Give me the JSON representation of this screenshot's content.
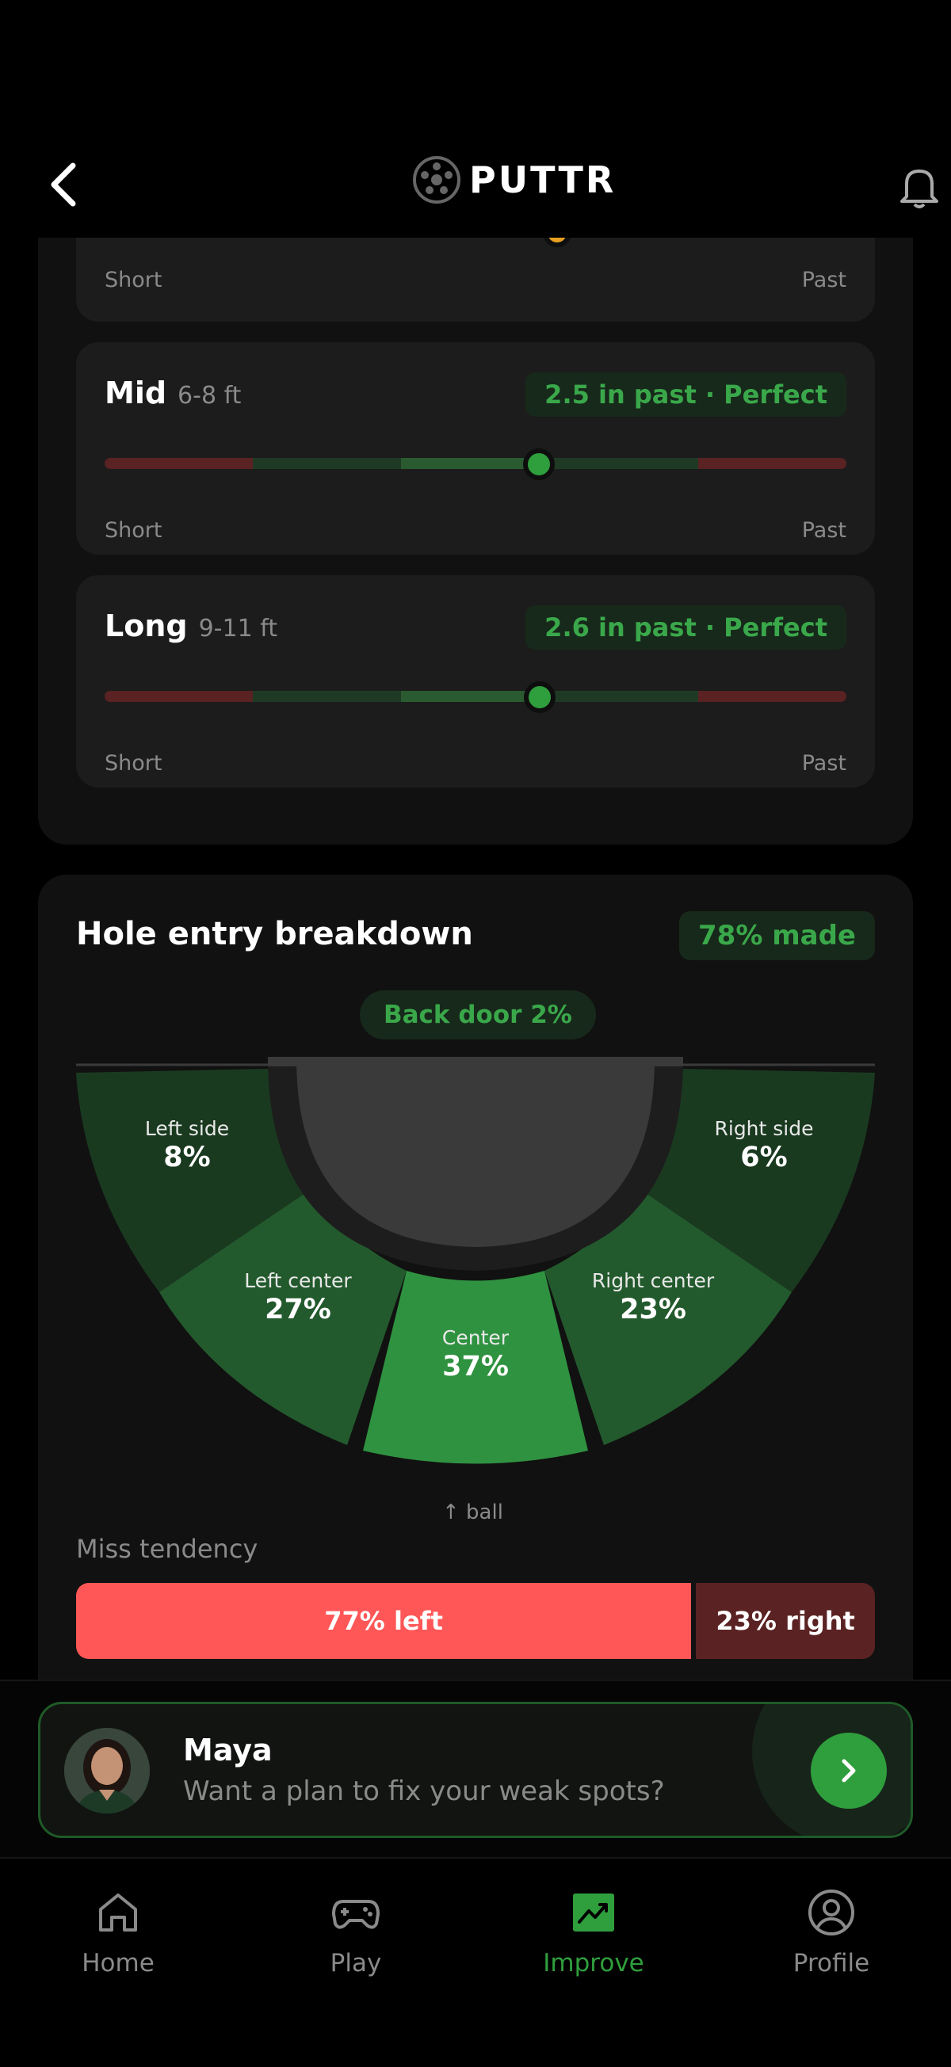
{
  "header": {
    "logo_text": "PUTTR"
  },
  "distance_rows": {
    "top": {
      "short": "Short",
      "past": "Past"
    },
    "mid": {
      "title": "Mid",
      "range": "6-8 ft",
      "badge": "2.5 in past · Perfect",
      "short": "Short",
      "past": "Past",
      "position": 0.585
    },
    "long": {
      "title": "Long",
      "range": "9-11 ft",
      "badge": "2.6 in past · Perfect",
      "short": "Short",
      "past": "Past",
      "position": 0.587
    }
  },
  "hole_entry": {
    "title": "Hole entry breakdown",
    "made_badge": "78% made",
    "backdoor": "Back door 2%",
    "sectors": [
      {
        "name": "Left side",
        "value": "8%"
      },
      {
        "name": "Left center",
        "value": "27%"
      },
      {
        "name": "Center",
        "value": "37%"
      },
      {
        "name": "Right center",
        "value": "23%"
      },
      {
        "name": "Right side",
        "value": "6%"
      }
    ],
    "ball_label": "↑ ball",
    "miss_tendency_label": "Miss tendency",
    "miss_left": "77% left",
    "miss_right": "23% right",
    "miss_left_fraction": 0.77
  },
  "coach": {
    "name": "Maya",
    "message": "Want a plan to fix your weak spots?"
  },
  "nav": {
    "items": [
      {
        "label": "Home",
        "icon": "home-icon"
      },
      {
        "label": "Play",
        "icon": "gamepad-icon"
      },
      {
        "label": "Improve",
        "icon": "chart-icon"
      },
      {
        "label": "Profile",
        "icon": "profile-icon"
      }
    ],
    "active": "Improve"
  },
  "colors": {
    "accent": "#2f9e3d",
    "miss_left": "#ff5757",
    "miss_right": "#5a2222",
    "sector_light": "#2f9240",
    "sector_mid": "#235a2d",
    "sector_dark": "#1a3a20"
  }
}
